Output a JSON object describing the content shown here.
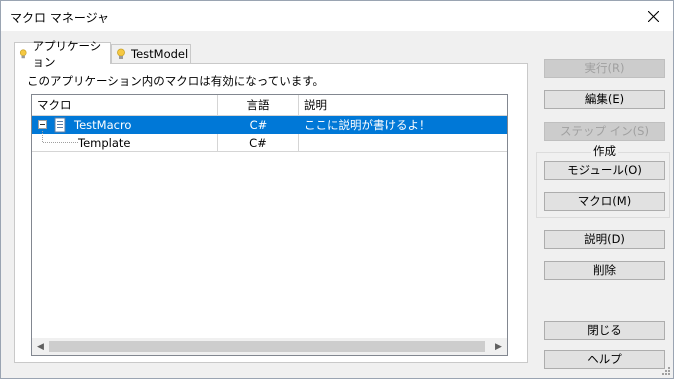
{
  "window": {
    "title": "マクロ マネージャ"
  },
  "tabs": [
    {
      "label": "アプリケーション",
      "icon": "lightbulb-icon",
      "active": true
    },
    {
      "label": "TestModel",
      "icon": "lightbulb-icon",
      "active": false
    }
  ],
  "panel": {
    "caption": "このアプリケーション内のマクロは有効になっています。"
  },
  "grid": {
    "columns": [
      "マクロ",
      "言語",
      "説明"
    ],
    "rows": [
      {
        "name": "TestMacro",
        "language": "C#",
        "description": "ここに説明が書けるよ！",
        "selected": true,
        "expander": "collapse"
      },
      {
        "name": "Template",
        "language": "C#",
        "description": "",
        "selected": false
      }
    ]
  },
  "buttons": {
    "run": "実行(R)",
    "edit": "編集(E)",
    "step_in": "ステップ イン(S)",
    "create_group_label": "作成",
    "module": "モジュール(O)",
    "macro": "マクロ(M)",
    "description": "説明(D)",
    "delete": "削除",
    "close": "閉じる",
    "help": "ヘルプ"
  },
  "colors": {
    "selection": "#0078d7",
    "window_bg": "#f0f0f0",
    "disabled_text": "#a0a0a0"
  }
}
